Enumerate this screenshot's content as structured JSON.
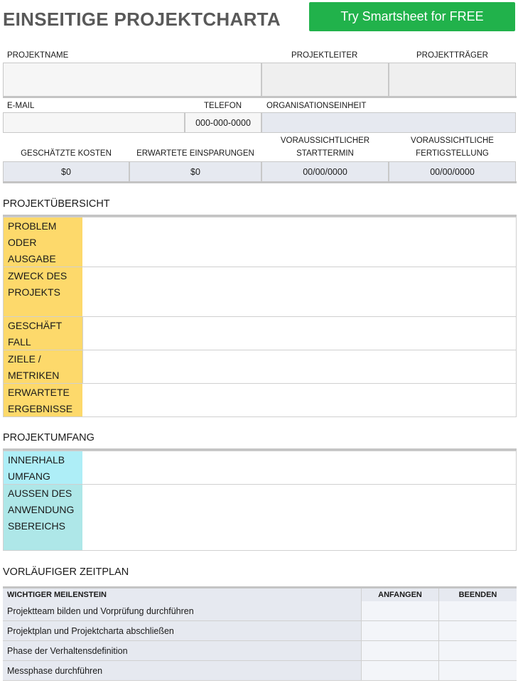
{
  "header": {
    "title": "EINSEITIGE PROJEKTCHARTA",
    "cta": "Try Smartsheet for FREE"
  },
  "info": {
    "projektname": "PROJEKTNAME",
    "projektleiter": "PROJEKTLEITER",
    "projekttraeger": "PROJEKTTRÄGER",
    "email": "E-MAIL",
    "telefon": "TELEFON",
    "telefon_value": "000-000-0000",
    "organisation": "ORGANISATIONSEINHEIT",
    "kosten": "GESCHÄTZTE KOSTEN",
    "kosten_value": "$0",
    "einsparungen": "ERWARTETE EINSPARUNGEN",
    "einsparungen_value": "$0",
    "start_line1": "VORAUSSICHTLICHER",
    "start_line2": "STARTTERMIN",
    "start_value": "00/00/0000",
    "end_line1": "VORAUSSICHTLICHE",
    "end_line2": "FERTIGSTELLUNG",
    "end_value": "00/00/0000"
  },
  "overview": {
    "title": "PROJEKTÜBERSICHT",
    "rows": [
      {
        "label": "PROBLEM ODER AUSGABE"
      },
      {
        "label": "ZWECK DES PROJEKTS"
      },
      {
        "label": "GESCHÄFT FALL"
      },
      {
        "label": "ZIELE / METRIKEN"
      },
      {
        "label": "ERWARTETE ERGEBNISSE"
      }
    ]
  },
  "scope": {
    "title": "PROJEKTUMFANG",
    "rows": [
      {
        "label": "INNERHALB UMFANG"
      },
      {
        "label": "AUßEN DES ANWENDUNG SBEREICHS"
      }
    ]
  },
  "timeline": {
    "title": "VORLÄUFIGER ZEITPLAN",
    "headers": {
      "milestone": "WICHTIGER MEILENSTEIN",
      "start": "ANFANGEN",
      "end": "BEENDEN"
    },
    "rows": [
      {
        "milestone": "Projektteam bilden und Vorprüfung durchführen"
      },
      {
        "milestone": "Projektplan und Projektcharta abschließen"
      },
      {
        "milestone": "Phase der Verhaltensdefinition"
      },
      {
        "milestone": "Messphase durchführen"
      }
    ]
  },
  "colors": {
    "cta": "#21b24b",
    "overview_label": "#fdd96b",
    "scope_inside": "#aeeef7",
    "scope_outside": "#aee7e8"
  }
}
